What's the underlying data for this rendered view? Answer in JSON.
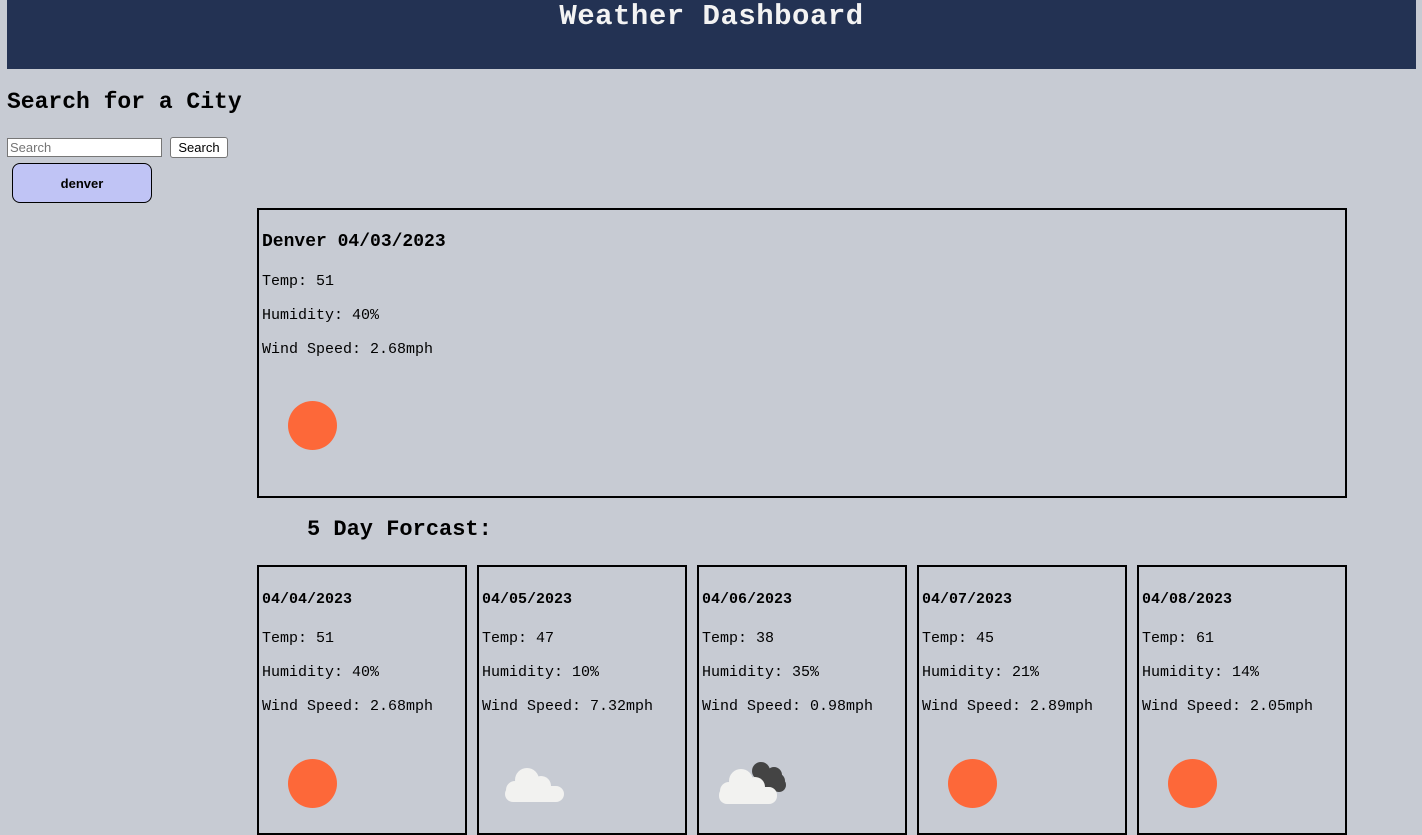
{
  "header": {
    "title": "Weather Dashboard"
  },
  "search": {
    "heading": "Search for a City",
    "placeholder": "Search",
    "button_label": "Search",
    "history": [
      "denver"
    ]
  },
  "current": {
    "title": "Denver 04/03/2023",
    "temp": "Temp: 51",
    "humidity": "Humidity: 40%",
    "wind": "Wind Speed: 2.68mph",
    "icon": "sun-icon"
  },
  "forecast": {
    "heading": "5 Day Forcast:",
    "days": [
      {
        "date": "04/04/2023",
        "temp": "Temp: 51",
        "humidity": "Humidity: 40%",
        "wind": "Wind Speed: 2.68mph",
        "icon": "sun-icon"
      },
      {
        "date": "04/05/2023",
        "temp": "Temp: 47",
        "humidity": "Humidity: 10%",
        "wind": "Wind Speed: 7.32mph",
        "icon": "cloud-icon"
      },
      {
        "date": "04/06/2023",
        "temp": "Temp: 38",
        "humidity": "Humidity: 35%",
        "wind": "Wind Speed: 0.98mph",
        "icon": "broken-clouds-icon"
      },
      {
        "date": "04/07/2023",
        "temp": "Temp: 45",
        "humidity": "Humidity: 21%",
        "wind": "Wind Speed: 2.89mph",
        "icon": "sun-icon"
      },
      {
        "date": "04/08/2023",
        "temp": "Temp: 61",
        "humidity": "Humidity: 14%",
        "wind": "Wind Speed: 2.05mph",
        "icon": "sun-icon"
      }
    ]
  },
  "colors": {
    "header_bg": "#233253",
    "page_bg": "#c7cbd3",
    "history_button_bg": "#c0c4f5",
    "sun": "#fd6839"
  }
}
